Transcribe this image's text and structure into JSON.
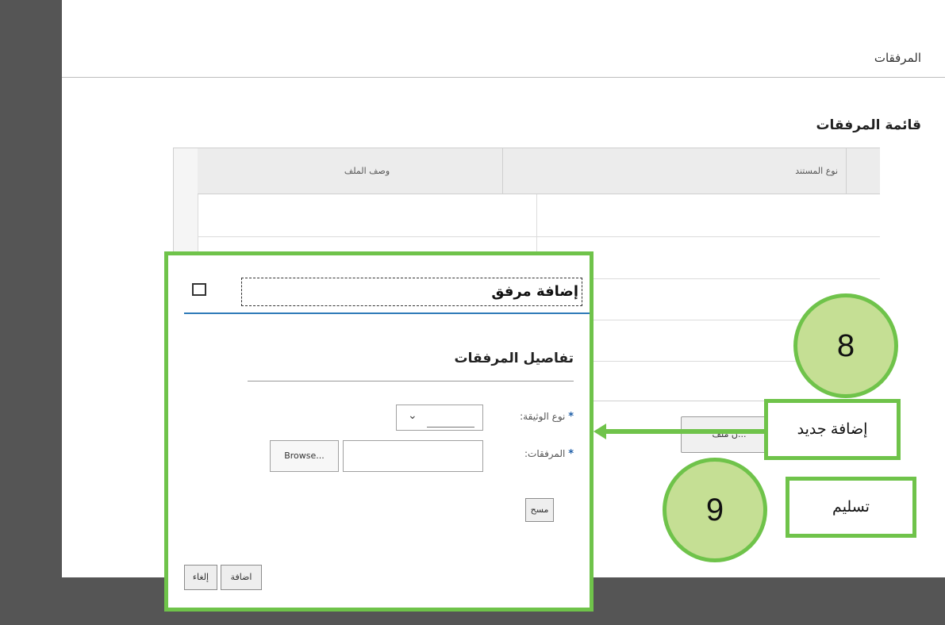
{
  "page": {
    "section_title": "المرفقات",
    "list_title": "قائمة المرفقات"
  },
  "grid": {
    "columns": [
      "نوع المستند",
      "وصف الملف"
    ]
  },
  "background_button": "...ن ملف",
  "dialog": {
    "title": "إضافة مرفق",
    "details_title": "تفاصيل المرفقات",
    "required_marker": "*",
    "doc_type_label": "نوع الوثيقة:",
    "attachments_label": "المرفقات:",
    "doc_type_value": "",
    "browse_label": "Browse...",
    "clear_label": "مسح",
    "add_label": "اضافة",
    "cancel_label": "إلغاء"
  },
  "annotations": {
    "step_8": "8",
    "step_9": "9",
    "new_label": "إضافة جديد",
    "submit_label": "تسليم",
    "accent_color": "#6fc34a"
  },
  "icons": {
    "dialog_maximize": "maximize-icon",
    "select_chevron": "chevron-down-icon"
  }
}
